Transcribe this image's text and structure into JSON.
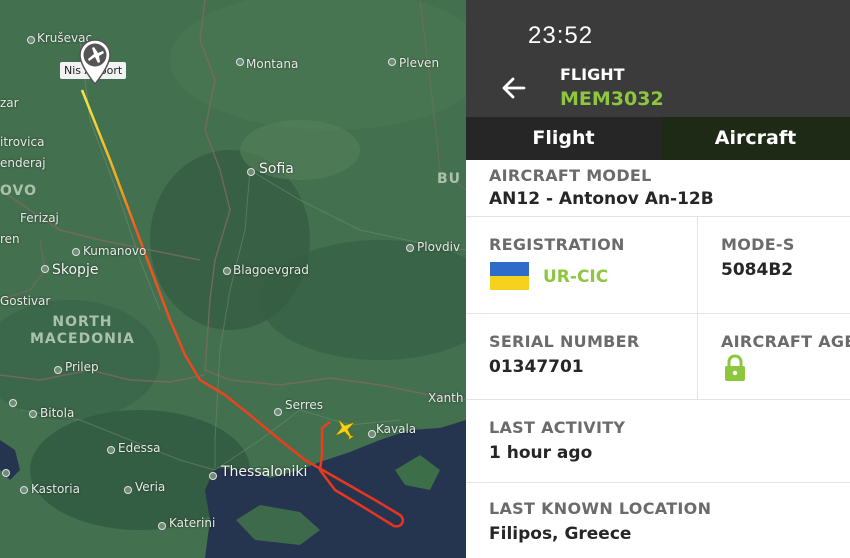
{
  "map": {
    "airport_label": "Nis Airport",
    "cities": {
      "krusevac": "Kruševac",
      "montana": "Montana",
      "pleven": "Pleven",
      "zar": "zar",
      "mitrovica": "itrovica",
      "enderaj": "enderaj",
      "sofia": "Sofia",
      "ferizaj": "Ferizaj",
      "kumanovo": "Kumanovo",
      "plovdiv": "Plovdiv",
      "ren": "ren",
      "skopje": "Skopje",
      "blagoevgrad": "Blagoevgrad",
      "gostivar": "Gostivar",
      "prilep": "Prilep",
      "bitola": "Bitola",
      "serres": "Serres",
      "kavala": "Kavala",
      "xanth": "Xanth",
      "edessa": "Edessa",
      "thessaloniki": "Thessaloniki",
      "kastoria": "Kastoria",
      "veria": "Veria",
      "katerini": "Katerini"
    },
    "countries": {
      "kosovo_partial": "OVO",
      "bulgaria_partial": "BU",
      "north_macedonia": "NORTH\nMACEDONIA"
    }
  },
  "header": {
    "time": "23:52",
    "flight_label": "FLIGHT",
    "flight_number": "MEM3032"
  },
  "tabs": {
    "flight": "Flight",
    "aircraft": "Aircraft"
  },
  "details": {
    "aircraft_model_label": "AIRCRAFT MODEL",
    "aircraft_model_value": "AN12 - Antonov An-12B",
    "registration_label": "REGISTRATION",
    "registration_value": "UR-CIC",
    "mode_s_label": "MODE-S",
    "mode_s_value": "5084B2",
    "serial_label": "SERIAL NUMBER",
    "serial_value": "01347701",
    "age_label": "AIRCRAFT AGE",
    "last_activity_label": "LAST ACTIVITY",
    "last_activity_value": "1 hour ago",
    "last_location_label": "LAST KNOWN LOCATION",
    "last_location_value": "Filipos, Greece"
  },
  "colors": {
    "accent_green": "#8dc63f",
    "header_bg": "#3b3b3b",
    "track_start": "#f2e94a",
    "track_end": "#e8321e",
    "flag_blue": "#2f6cc9",
    "flag_yellow": "#f6d21f"
  },
  "icons": {
    "back": "arrow-left-icon",
    "pin": "airport-pin-icon",
    "plane": "airplane-icon",
    "flag": "ukraine-flag-icon",
    "lock": "lock-icon"
  }
}
